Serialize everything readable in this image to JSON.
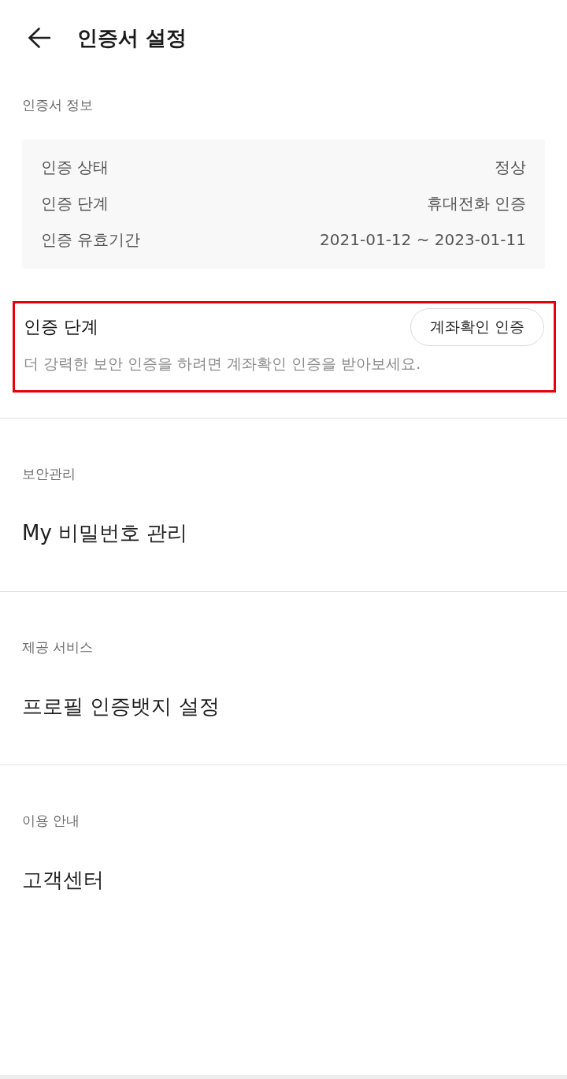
{
  "header": {
    "title": "인증서 설정"
  },
  "certificate_info": {
    "label": "인증서 정보",
    "rows": [
      {
        "label": "인증 상태",
        "value": "정상"
      },
      {
        "label": "인증 단계",
        "value": "휴대전화 인증"
      },
      {
        "label": "인증 유효기간",
        "value": "2021-01-12 ~ 2023-01-11"
      }
    ]
  },
  "auth_level": {
    "title": "인증 단계",
    "button": "계좌확인 인증",
    "description": "더 강력한 보안 인증을 하려면 계좌확인 인증을 받아보세요.",
    "highlighted": true
  },
  "sections": [
    {
      "label": "보안관리",
      "items": [
        "My 비밀번호 관리"
      ]
    },
    {
      "label": "제공 서비스",
      "items": [
        "프로필 인증뱃지 설정"
      ]
    },
    {
      "label": "이용 안내",
      "items": [
        "고객센터"
      ]
    }
  ]
}
